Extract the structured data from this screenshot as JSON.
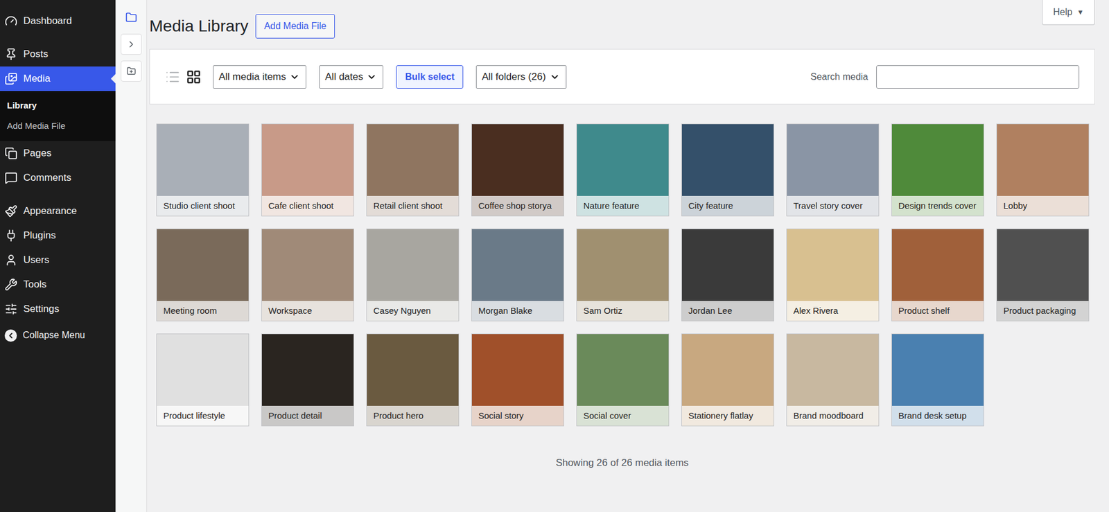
{
  "sidebar": {
    "items": [
      {
        "label": "Dashboard",
        "selected": false
      },
      {
        "label": "Posts",
        "selected": false
      },
      {
        "label": "Media",
        "selected": true
      },
      {
        "label": "Pages",
        "selected": false
      },
      {
        "label": "Comments",
        "selected": false
      },
      {
        "label": "Appearance",
        "selected": false
      },
      {
        "label": "Plugins",
        "selected": false
      },
      {
        "label": "Users",
        "selected": false
      },
      {
        "label": "Tools",
        "selected": false
      },
      {
        "label": "Settings",
        "selected": false
      }
    ],
    "submenu": [
      {
        "label": "Library",
        "selected": true
      },
      {
        "label": "Add Media File",
        "selected": false
      }
    ],
    "collapse": "Collapse Menu"
  },
  "header": {
    "title": "Media Library",
    "add_button": "Add Media File",
    "help": {
      "label": "Help",
      "arrow": "▼"
    }
  },
  "toolbar": {
    "views": [
      {
        "kind": "list",
        "selected": false
      },
      {
        "kind": "grid",
        "selected": true
      }
    ],
    "type_filter": "All media items",
    "date_filter": "All dates",
    "bulk_button": "Bulk select",
    "folder_filter": "All folders (26)",
    "search": {
      "label": "Search media",
      "value": ""
    }
  },
  "media": [
    {
      "title": "Studio client shoot",
      "color": "#a9afb7"
    },
    {
      "title": "Cafe client shoot",
      "color": "#c89a88"
    },
    {
      "title": "Retail client shoot",
      "color": "#8f7560"
    },
    {
      "title": "Coffee shop storya",
      "color": "#4a2e20"
    },
    {
      "title": "Nature feature",
      "color": "#3f8a8c"
    },
    {
      "title": "City feature",
      "color": "#34506a"
    },
    {
      "title": "Travel story cover",
      "color": "#8a95a5"
    },
    {
      "title": "Design trends cover",
      "color": "#4f8a3a"
    },
    {
      "title": "Lobby",
      "color": "#b08060"
    },
    {
      "title": "Meeting room",
      "color": "#7a6a5a"
    },
    {
      "title": "Workspace",
      "color": "#a08a78"
    },
    {
      "title": "Casey Nguyen",
      "color": "#a8a6a0"
    },
    {
      "title": "Morgan Blake",
      "color": "#6a7a88"
    },
    {
      "title": "Sam Ortiz",
      "color": "#a09070"
    },
    {
      "title": "Jordan Lee",
      "color": "#3a3a3a"
    },
    {
      "title": "Alex Rivera",
      "color": "#d8c090"
    },
    {
      "title": "Product shelf",
      "color": "#a0603a"
    },
    {
      "title": "Product packaging",
      "color": "#505050"
    },
    {
      "title": "Product lifestyle",
      "color": "#e0e0e0"
    },
    {
      "title": "Product detail",
      "color": "#2a2520"
    },
    {
      "title": "Product hero",
      "color": "#6a5a40"
    },
    {
      "title": "Social story",
      "color": "#a0502a"
    },
    {
      "title": "Social cover",
      "color": "#6a8a5a"
    },
    {
      "title": "Stationery flatlay",
      "color": "#c8a880"
    },
    {
      "title": "Brand moodboard",
      "color": "#c8b8a0"
    },
    {
      "title": "Brand desk setup",
      "color": "#4a80b0"
    }
  ],
  "footer": "Showing 26 of 26 media items"
}
